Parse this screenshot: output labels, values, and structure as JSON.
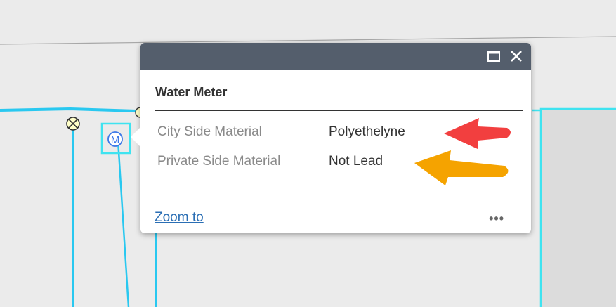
{
  "popup": {
    "title": "Water Meter",
    "maximize_icon": "maximize-icon",
    "close_icon": "close-icon",
    "attributes": [
      {
        "label": "City Side Material",
        "value": "Polyethelyne"
      },
      {
        "label": "Private Side Material",
        "value": "Not Lead"
      }
    ],
    "zoom_link": "Zoom to",
    "more_label": "•••"
  },
  "map": {
    "meter_symbol": "M",
    "valve_icon": "valve-icon"
  },
  "colors": {
    "header": "#545e6c",
    "pipe": "#29c8f0",
    "parcel": "#3fe3f0",
    "link": "#2a6eb4",
    "red_arrow": "#f23f3f",
    "orange_arrow": "#f5a300"
  }
}
